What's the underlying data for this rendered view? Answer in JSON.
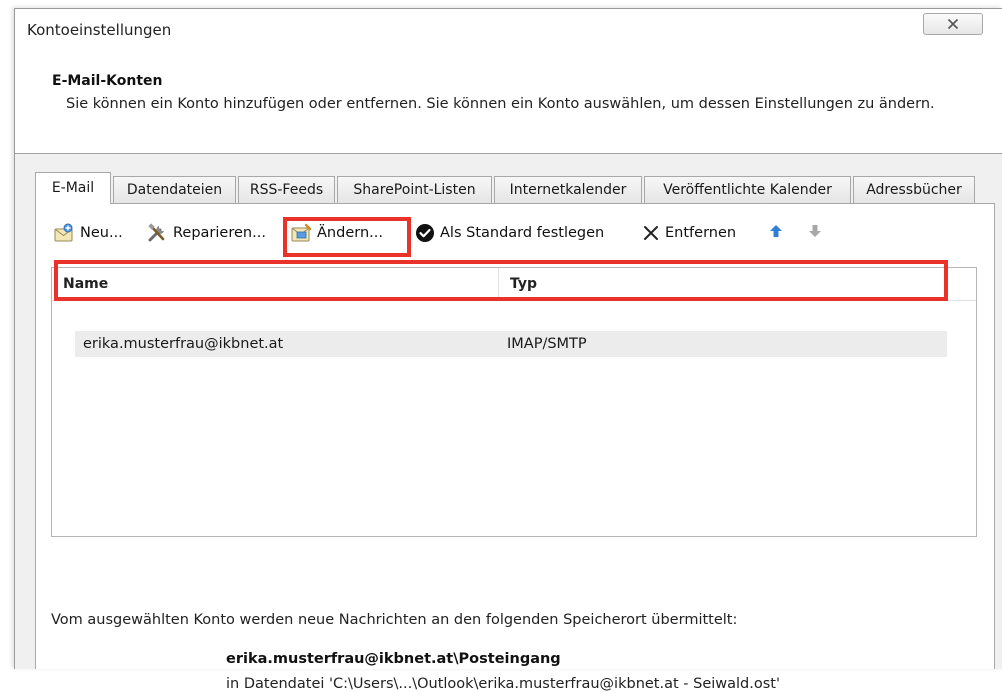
{
  "window": {
    "title": "Kontoeinstellungen",
    "close_icon": "close-x-icon"
  },
  "header": {
    "title": "E-Mail-Konten",
    "description": "Sie können ein Konto hinzufügen oder entfernen. Sie können ein Konto auswählen, um dessen Einstellungen zu ändern."
  },
  "tabs": [
    {
      "label": "E-Mail",
      "active": true
    },
    {
      "label": "Datendateien",
      "active": false
    },
    {
      "label": "RSS-Feeds",
      "active": false
    },
    {
      "label": "SharePoint-Listen",
      "active": false
    },
    {
      "label": "Internetkalender",
      "active": false
    },
    {
      "label": "Veröffentlichte Kalender",
      "active": false
    },
    {
      "label": "Adressbücher",
      "active": false
    }
  ],
  "toolbar": {
    "new_label": "Neu...",
    "repair_label": "Reparieren...",
    "change_label": "Ändern...",
    "set_default_label": "Als Standard festlegen",
    "remove_label": "Entfernen",
    "icons": [
      "new-account-icon",
      "repair-tools-icon",
      "change-account-icon",
      "checkmark-icon",
      "remove-x-icon",
      "arrow-up-icon",
      "arrow-down-icon"
    ]
  },
  "account_list": {
    "columns": [
      "Name",
      "Typ"
    ],
    "rows": [
      {
        "name": "erika.musterfrau@ikbnet.at",
        "type": "IMAP/SMTP",
        "selected": true
      }
    ]
  },
  "delivery": {
    "info": "Vom ausgewählten Konto werden neue Nachrichten an den folgenden Speicherort übermittelt:",
    "location": "erika.musterfrau@ikbnet.at\\Posteingang",
    "data_file": "in Datendatei 'C:\\Users\\...\\Outlook\\erika.musterfrau@ikbnet.at - Seiwald.ost'"
  },
  "colors": {
    "highlight": "#e8322a",
    "panel_background": "#f0f0f0",
    "arrow_up": "#2f7fd8",
    "arrow_down": "#a8a8a8"
  }
}
